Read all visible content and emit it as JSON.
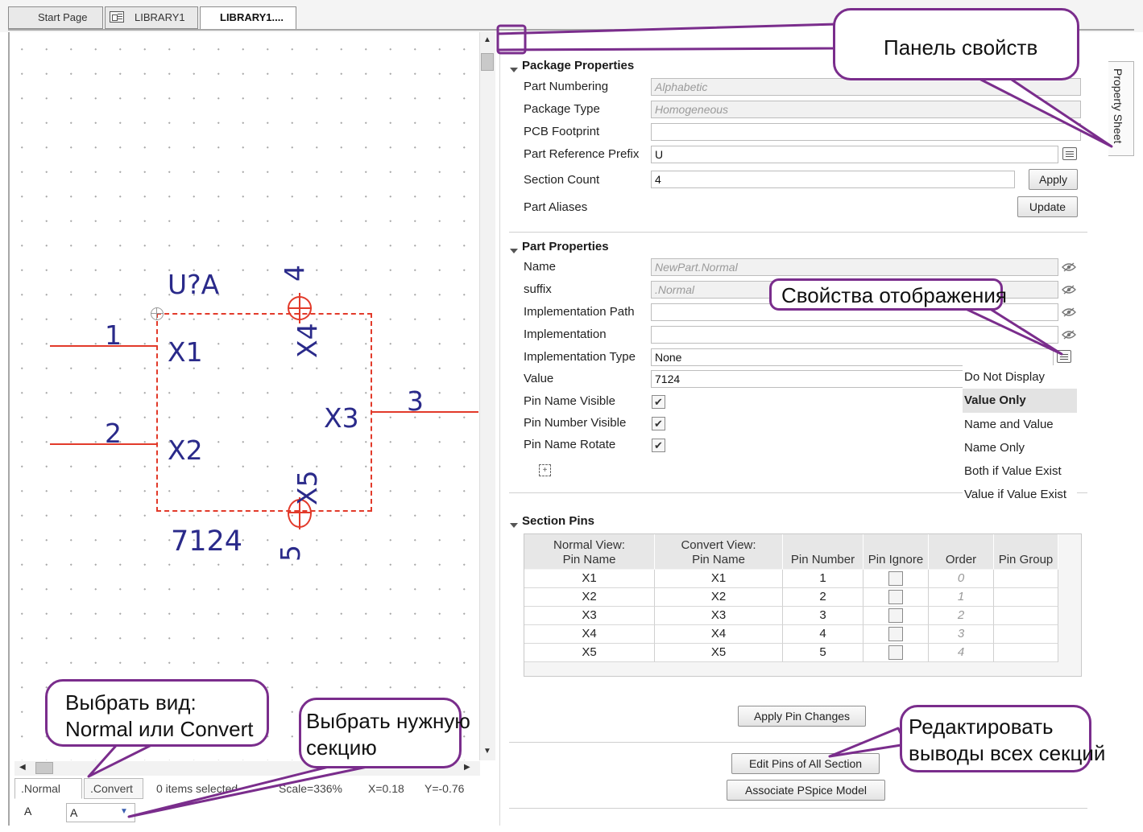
{
  "tabs": [
    {
      "label": "Start Page"
    },
    {
      "label": "LIBRARY1"
    },
    {
      "label": "LIBRARY1...."
    }
  ],
  "schematic": {
    "ref": "U?A",
    "value": "7124",
    "pins": [
      {
        "number": "1",
        "name": "X1"
      },
      {
        "number": "2",
        "name": "X2"
      },
      {
        "number": "3",
        "name": "X3"
      },
      {
        "number": "4",
        "name": "X4"
      },
      {
        "number": "5",
        "name": "X5"
      }
    ]
  },
  "status": {
    "view_tabs": [
      ".Normal",
      ".Convert"
    ],
    "items_selected": "0 items selected",
    "scale": "Scale=336%",
    "x": "X=0.18",
    "y": "Y=-0.76",
    "section_label": "A",
    "section_value": "A"
  },
  "package": {
    "title": "Package Properties",
    "part_numbering_label": "Part Numbering",
    "part_numbering": "Alphabetic",
    "package_type_label": "Package Type",
    "package_type": "Homogeneous",
    "pcb_footprint_label": "PCB Footprint",
    "pcb_footprint": "",
    "prefix_label": "Part Reference Prefix",
    "prefix": "U",
    "section_count_label": "Section Count",
    "section_count": "4",
    "apply": "Apply",
    "aliases_label": "Part Aliases",
    "update": "Update"
  },
  "part": {
    "title": "Part Properties",
    "name_label": "Name",
    "name": "NewPart.Normal",
    "suffix_label": "suffix",
    "suffix": ".Normal",
    "impl_path_label": "Implementation Path",
    "impl_path": "",
    "impl_label": "Implementation",
    "impl": "",
    "impl_type_label": "Implementation Type",
    "impl_type": "None",
    "value_label": "Value",
    "value": "7124",
    "pin_name_visible_label": "Pin Name Visible",
    "pin_number_visible_label": "Pin Number Visible",
    "pin_name_rotate_label": "Pin Name Rotate",
    "pin_name_visible": true,
    "pin_number_visible": true,
    "pin_name_rotate": true
  },
  "display_dropdown": {
    "options": [
      "Do Not Display",
      "Value Only",
      "Name and Value",
      "Name Only",
      "Both if Value Exist",
      "Value if Value Exist"
    ],
    "selected": "Value Only"
  },
  "section_pins": {
    "title": "Section Pins",
    "headers": [
      "Normal View:\nPin Name",
      "Convert View:\nPin Name",
      "Pin Number",
      "Pin Ignore",
      "Order",
      "Pin Group"
    ],
    "rows": [
      [
        "X1",
        "X1",
        "1",
        "",
        "0",
        ""
      ],
      [
        "X2",
        "X2",
        "2",
        "",
        "1",
        ""
      ],
      [
        "X3",
        "X3",
        "3",
        "",
        "2",
        ""
      ],
      [
        "X4",
        "X4",
        "4",
        "",
        "3",
        ""
      ],
      [
        "X5",
        "X5",
        "5",
        "",
        "4",
        ""
      ]
    ],
    "apply_pin_changes": "Apply Pin Changes",
    "edit_pins_all": "Edit Pins of All Section",
    "associate_pspice": "Associate PSpice Model"
  },
  "side_tab": "Property Sheet",
  "callouts": {
    "property_panel": "Панель свойств",
    "display_props": "Свойства отображения",
    "choose_view": "Выбрать вид:\nNormal или Convert",
    "choose_section": "Выбрать нужную\nсекцию",
    "edit_all_pins": "Редактировать\nвыводы всех секций"
  },
  "colors": {
    "callout_border": "#7a2d8c",
    "pin_red": "#e23a2a",
    "symbol_text": "#2a2a8a"
  }
}
